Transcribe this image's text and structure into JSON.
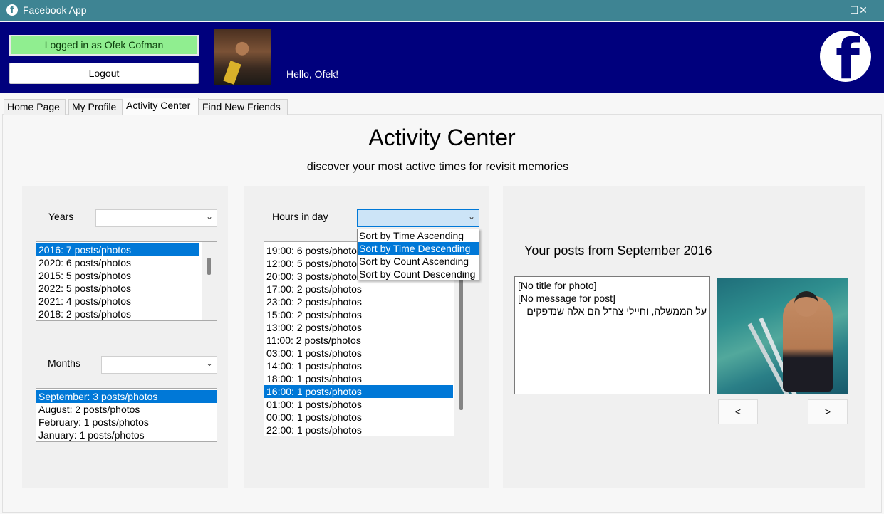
{
  "window": {
    "title": "Facebook App",
    "minimize": "—",
    "maximize": "☐",
    "close": "✕"
  },
  "header": {
    "logged_in_label": "Logged in as Ofek Cofman",
    "logout_label": "Logout",
    "greeting": "Hello, Ofek!",
    "logo_letter": "f",
    "bg_color": "#00007d"
  },
  "tabs": [
    {
      "label": "Home Page"
    },
    {
      "label": "My Profile"
    },
    {
      "label": "Activity Center",
      "active": true
    },
    {
      "label": "Find New Friends"
    }
  ],
  "page": {
    "title": "Activity Center",
    "subtitle": "discover your most active times for revisit memories"
  },
  "years": {
    "label": "Years",
    "combo_value": "",
    "items": [
      "2016: 7 posts/photos",
      "2020: 6 posts/photos",
      "2015: 5 posts/photos",
      "2022: 5 posts/photos",
      "2021: 4 posts/photos",
      "2018: 2 posts/photos"
    ],
    "selected_index": 0
  },
  "months": {
    "label": "Months",
    "combo_value": "",
    "items": [
      "September: 3 posts/photos",
      "August: 2 posts/photos",
      "February: 1 posts/photos",
      "January: 1 posts/photos"
    ],
    "selected_index": 0
  },
  "hours": {
    "label": "Hours in day",
    "combo_value": "",
    "dropdown_options": [
      "Sort by Time Ascending",
      "Sort by Time Descending",
      "Sort by Count Ascending",
      "Sort by Count Descending"
    ],
    "dropdown_selected_index": 1,
    "items": [
      "19:00: 6 posts/photos",
      "12:00: 5 posts/photos",
      "20:00: 3 posts/photos",
      "17:00: 2 posts/photos",
      "23:00: 2 posts/photos",
      "15:00: 2 posts/photos",
      "13:00: 2 posts/photos",
      "11:00: 2 posts/photos",
      "03:00: 1 posts/photos",
      "14:00: 1 posts/photos",
      "18:00: 1 posts/photos",
      "16:00: 1 posts/photos",
      "01:00: 1 posts/photos",
      "00:00: 1 posts/photos",
      "22:00: 1 posts/photos"
    ],
    "selected_index": 11
  },
  "posts": {
    "title": "Your posts from September 2016",
    "lines": [
      "[No title for photo]",
      "[No message for post]",
      "על הממשלה, וחיילי צה\"ל הם אלה שנדפקים"
    ],
    "prev_label": "<",
    "next_label": ">"
  },
  "colors": {
    "accent": "#0078d7",
    "titlebar": "#3e8493",
    "logged_in_bg": "#90ee90"
  }
}
